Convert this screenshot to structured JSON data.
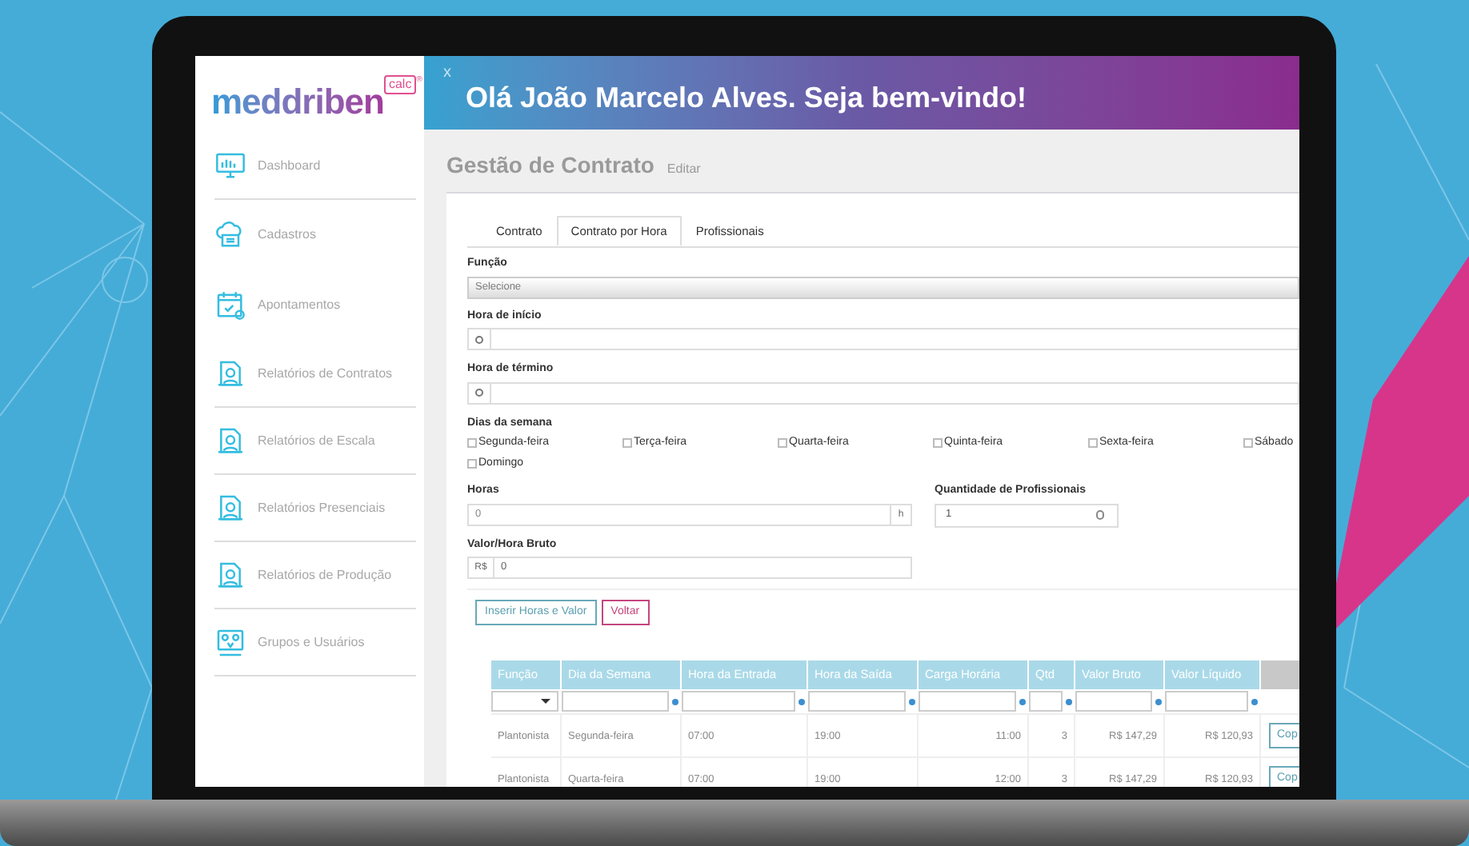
{
  "logo": {
    "name": "meddriben",
    "badge": "calc",
    "mark": "®"
  },
  "sidebar": {
    "items": [
      {
        "label": "Dashboard"
      },
      {
        "label": "Cadastros"
      },
      {
        "label": "Apontamentos"
      },
      {
        "label": "Relatórios de Contratos"
      },
      {
        "label": "Relatórios de Escala"
      },
      {
        "label": "Relatórios Presenciais"
      },
      {
        "label": "Relatórios de Produção"
      },
      {
        "label": "Grupos e Usuários"
      }
    ]
  },
  "banner": {
    "close": "x",
    "greeting": "Olá João Marcelo Alves. Seja bem-vindo!"
  },
  "page": {
    "title": "Gestão de Contrato",
    "subtitle": "Editar"
  },
  "tabs": [
    {
      "label": "Contrato",
      "selected": false
    },
    {
      "label": "Contrato por Hora",
      "selected": true
    },
    {
      "label": "Profissionais",
      "selected": false
    }
  ],
  "form": {
    "funcao": {
      "label": "Função",
      "placeholder": "Selecione"
    },
    "hora_inicio": {
      "label": "Hora de início"
    },
    "hora_termino": {
      "label": "Hora de término"
    },
    "dias": {
      "label": "Dias da semana",
      "options": [
        {
          "label": "Segunda-feira",
          "checked": false
        },
        {
          "label": "Terça-feira",
          "checked": false
        },
        {
          "label": "Quarta-feira",
          "checked": false
        },
        {
          "label": "Quinta-feira",
          "checked": false
        },
        {
          "label": "Sexta-feira",
          "checked": false
        },
        {
          "label": "Sábado",
          "checked": false
        },
        {
          "label": "Domingo",
          "checked": false
        }
      ]
    },
    "horas": {
      "label": "Horas",
      "value": "0",
      "suffix": "h"
    },
    "quantidade": {
      "label": "Quantidade de Profissionais",
      "value": "1"
    },
    "valor": {
      "label": "Valor/Hora Bruto",
      "prefix": "R$",
      "value": "0"
    },
    "buttons": [
      {
        "label": "Inserir Horas e Valor",
        "kind": "primary"
      },
      {
        "label": "Voltar",
        "kind": "secondary"
      }
    ]
  },
  "table": {
    "columns": [
      "Função",
      "Dia da Semana",
      "Hora da Entrada",
      "Hora da Saída",
      "Carga Horária",
      "Qtd",
      "Valor Bruto",
      "Valor Líquido"
    ],
    "rows": [
      {
        "cells": [
          "Plantonista",
          "Segunda-feira",
          "07:00",
          "19:00",
          "11:00",
          "3",
          "R$ 147,29",
          "R$ 120,93"
        ],
        "action": "Cop"
      },
      {
        "cells": [
          "Plantonista",
          "Quarta-feira",
          "07:00",
          "19:00",
          "12:00",
          "3",
          "R$ 147,29",
          "R$ 120,93"
        ],
        "action": "Cop"
      }
    ]
  }
}
